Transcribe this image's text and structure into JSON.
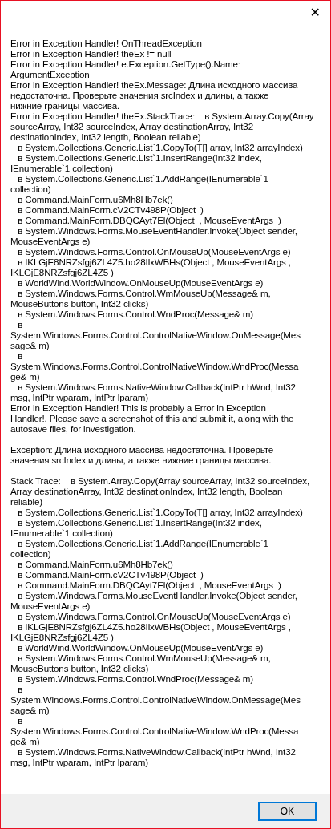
{
  "window": {
    "close_glyph": "✕"
  },
  "blocks": [
    {
      "lines": [
        "Error in Exception Handler! OnThreadException",
        "Error in Exception Handler! theEx != null",
        "Error in Exception Handler! e.Exception.GetType().Name:",
        "ArgumentException",
        "Error in Exception Handler! theEx.Message: Длина исходного массива",
        "недостаточна. Проверьте значения srcIndex и длины, а также",
        "нижние границы массива.",
        "Error in Exception Handler! theEx.StackTrace:    в System.Array.Copy(Array",
        "sourceArray, Int32 sourceIndex, Array destinationArray, Int32",
        "destinationIndex, Int32 length, Boolean reliable)",
        "   в System.Collections.Generic.List`1.CopyTo(T[] array, Int32 arrayIndex)",
        "   в System.Collections.Generic.List`1.InsertRange(Int32 index,",
        "IEnumerable`1 collection)",
        "   в System.Collections.Generic.List`1.AddRange(IEnumerable`1",
        "collection)",
        "   в Command.MainForm.u6Mh8Hb7ek()",
        "   в Command.MainForm.cV2CTv498P(Object  )",
        "   в Command.MainForm.DBQCAyt7El(Object  , MouseEventArgs  )",
        "   в System.Windows.Forms.MouseEventHandler.Invoke(Object sender,",
        "MouseEventArgs e)",
        "   в System.Windows.Forms.Control.OnMouseUp(MouseEventArgs e)",
        "   в IKLGjE8NRZsfgj6ZL4Z5.ho28IlxWBHs(Object , MouseEventArgs ,",
        "IKLGjE8NRZsfgj6ZL4Z5 )",
        "   в WorldWind.WorldWindow.OnMouseUp(MouseEventArgs e)",
        "   в System.Windows.Forms.Control.WmMouseUp(Message& m,",
        "MouseButtons button, Int32 clicks)",
        "   в System.Windows.Forms.Control.WndProc(Message& m)",
        "   в",
        "System.Windows.Forms.Control.ControlNativeWindow.OnMessage(Mes",
        "sage& m)",
        "   в",
        "System.Windows.Forms.Control.ControlNativeWindow.WndProc(Messa",
        "ge& m)",
        "   в System.Windows.Forms.NativeWindow.Callback(IntPtr hWnd, Int32",
        "msg, IntPtr wparam, IntPtr lparam)",
        "Error in Exception Handler! This is probably a Error in Exception",
        "Handler!. Please save a screenshot of this and submit it, along with the",
        "autosave files, for investigation."
      ]
    },
    {
      "lines": [
        "Exception: Длина исходного массива недостаточна. Проверьте",
        "значения srcIndex и длины, а также нижние границы массива."
      ]
    },
    {
      "lines": [
        "Stack Trace:    в System.Array.Copy(Array sourceArray, Int32 sourceIndex,",
        "Array destinationArray, Int32 destinationIndex, Int32 length, Boolean",
        "reliable)",
        "   в System.Collections.Generic.List`1.CopyTo(T[] array, Int32 arrayIndex)",
        "   в System.Collections.Generic.List`1.InsertRange(Int32 index,",
        "IEnumerable`1 collection)",
        "   в System.Collections.Generic.List`1.AddRange(IEnumerable`1",
        "collection)",
        "   в Command.MainForm.u6Mh8Hb7ek()",
        "   в Command.MainForm.cV2CTv498P(Object  )",
        "   в Command.MainForm.DBQCAyt7El(Object  , MouseEventArgs  )",
        "   в System.Windows.Forms.MouseEventHandler.Invoke(Object sender,",
        "MouseEventArgs e)",
        "   в System.Windows.Forms.Control.OnMouseUp(MouseEventArgs e)",
        "   в IKLGjE8NRZsfgj6ZL4Z5.ho28IlxWBHs(Object , MouseEventArgs ,",
        "IKLGjE8NRZsfgj6ZL4Z5 )",
        "   в WorldWind.WorldWindow.OnMouseUp(MouseEventArgs e)",
        "   в System.Windows.Forms.Control.WmMouseUp(Message& m,",
        "MouseButtons button, Int32 clicks)",
        "   в System.Windows.Forms.Control.WndProc(Message& m)",
        "   в",
        "System.Windows.Forms.Control.ControlNativeWindow.OnMessage(Mes",
        "sage& m)",
        "   в",
        "System.Windows.Forms.Control.ControlNativeWindow.WndProc(Messa",
        "ge& m)",
        "   в System.Windows.Forms.NativeWindow.Callback(IntPtr hWnd, Int32",
        "msg, IntPtr wparam, IntPtr lparam)"
      ]
    }
  ],
  "buttons": [
    {
      "label": "OK",
      "selected": true
    }
  ]
}
